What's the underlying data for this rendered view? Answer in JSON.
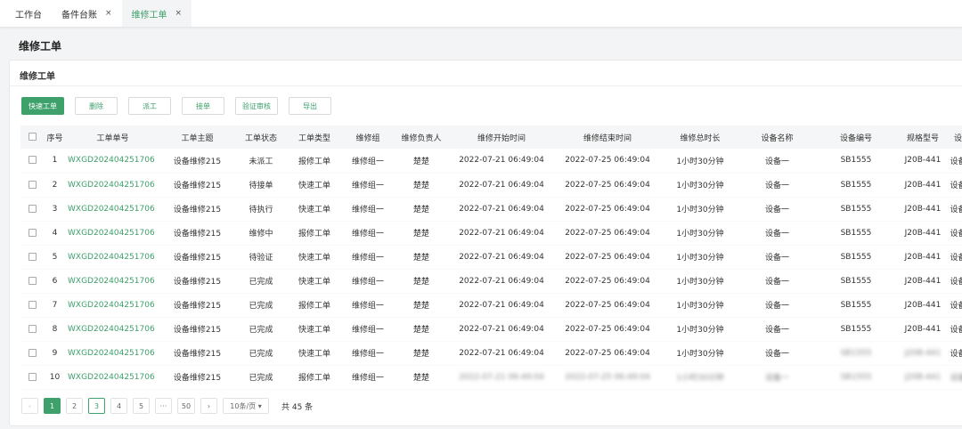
{
  "tabs": [
    {
      "label": "工作台",
      "closable": false,
      "active": false
    },
    {
      "label": "备件台账",
      "closable": true,
      "active": false
    },
    {
      "label": "维修工单",
      "closable": true,
      "active": true
    }
  ],
  "close_glyph": "×",
  "page_title": "维修工单",
  "card_title": "维修工单",
  "toolbar": {
    "quick": "快速工单",
    "delete": "删除",
    "dispatch": "派工",
    "accept": "接单",
    "verify": "验证审核",
    "export": "导出"
  },
  "columns": [
    "序号",
    "工单单号",
    "工单主题",
    "工单状态",
    "工单类型",
    "维修组",
    "维修负责人",
    "维修开始时间",
    "维修结束时间",
    "维修总时长",
    "设备名称",
    "设备编号",
    "规格型号",
    "设备类型"
  ],
  "rows": [
    {
      "no": "1",
      "order_no": "WXGD202404251706",
      "subject": "设备维修215",
      "status": "未派工",
      "type": "报修工单",
      "group": "维修组一",
      "owner": "楚楚",
      "start": "2022-07-21 06:49:04",
      "end": "2022-07-25 06:49:04",
      "duration": "1小时30分钟",
      "device": "设备一",
      "device_no": "SB1555",
      "model": "J20B-441",
      "device_type": "设备类型一"
    },
    {
      "no": "2",
      "order_no": "WXGD202404251706",
      "subject": "设备维修215",
      "status": "待接单",
      "type": "快速工单",
      "group": "维修组一",
      "owner": "楚楚",
      "start": "2022-07-21 06:49:04",
      "end": "2022-07-25 06:49:04",
      "duration": "1小时30分钟",
      "device": "设备一",
      "device_no": "SB1555",
      "model": "J20B-441",
      "device_type": "设备类型一"
    },
    {
      "no": "3",
      "order_no": "WXGD202404251706",
      "subject": "设备维修215",
      "status": "待执行",
      "type": "快速工单",
      "group": "维修组一",
      "owner": "楚楚",
      "start": "2022-07-21 06:49:04",
      "end": "2022-07-25 06:49:04",
      "duration": "1小时30分钟",
      "device": "设备一",
      "device_no": "SB1555",
      "model": "J20B-441",
      "device_type": "设备类型一"
    },
    {
      "no": "4",
      "order_no": "WXGD202404251706",
      "subject": "设备维修215",
      "status": "维修中",
      "type": "报修工单",
      "group": "维修组一",
      "owner": "楚楚",
      "start": "2022-07-21 06:49:04",
      "end": "2022-07-25 06:49:04",
      "duration": "1小时30分钟",
      "device": "设备一",
      "device_no": "SB1555",
      "model": "J20B-441",
      "device_type": "设备类型一"
    },
    {
      "no": "5",
      "order_no": "WXGD202404251706",
      "subject": "设备维修215",
      "status": "待验证",
      "type": "快速工单",
      "group": "维修组一",
      "owner": "楚楚",
      "start": "2022-07-21 06:49:04",
      "end": "2022-07-25 06:49:04",
      "duration": "1小时30分钟",
      "device": "设备一",
      "device_no": "SB1555",
      "model": "J20B-441",
      "device_type": "设备类型一"
    },
    {
      "no": "6",
      "order_no": "WXGD202404251706",
      "subject": "设备维修215",
      "status": "已完成",
      "type": "快速工单",
      "group": "维修组一",
      "owner": "楚楚",
      "start": "2022-07-21 06:49:04",
      "end": "2022-07-25 06:49:04",
      "duration": "1小时30分钟",
      "device": "设备一",
      "device_no": "SB1555",
      "model": "J20B-441",
      "device_type": "设备类型一"
    },
    {
      "no": "7",
      "order_no": "WXGD202404251706",
      "subject": "设备维修215",
      "status": "已完成",
      "type": "报修工单",
      "group": "维修组一",
      "owner": "楚楚",
      "start": "2022-07-21 06:49:04",
      "end": "2022-07-25 06:49:04",
      "duration": "1小时30分钟",
      "device": "设备一",
      "device_no": "SB1555",
      "model": "J20B-441",
      "device_type": "设备类型一"
    },
    {
      "no": "8",
      "order_no": "WXGD202404251706",
      "subject": "设备维修215",
      "status": "已完成",
      "type": "快速工单",
      "group": "维修组一",
      "owner": "楚楚",
      "start": "2022-07-21 06:49:04",
      "end": "2022-07-25 06:49:04",
      "duration": "1小时30分钟",
      "device": "设备一",
      "device_no": "SB1555",
      "model": "J20B-441",
      "device_type": "设备类型一"
    },
    {
      "no": "9",
      "order_no": "WXGD202404251706",
      "subject": "设备维修215",
      "status": "已完成",
      "type": "快速工单",
      "group": "维修组一",
      "owner": "楚楚",
      "start": "2022-07-21 06:49:04",
      "end": "2022-07-25 06:49:04",
      "duration": "1小时30分钟",
      "device": "设备一",
      "device_no": "SB1555",
      "model": "J20B-441",
      "device_type": "设备类型一"
    },
    {
      "no": "10",
      "order_no": "WXGD202404251706",
      "subject": "设备维修215",
      "status": "已完成",
      "type": "报修工单",
      "group": "维修组一",
      "owner": "楚楚",
      "start": "2022-07-21 06:49:04",
      "end": "2022-07-25 06:49:04",
      "duration": "1小时30分钟",
      "device": "设备一",
      "device_no": "SB1555",
      "model": "J20B-441",
      "device_type": "设备类型一"
    }
  ],
  "pagination": {
    "prev": "‹",
    "pages": [
      "1",
      "2",
      "3",
      "4",
      "5"
    ],
    "current": "1",
    "ellipsis": "···",
    "last": "50",
    "next": "›",
    "page_size": "10条/页 ▾",
    "total": "共 45 条"
  },
  "colors": {
    "accent": "#3ea06a"
  }
}
